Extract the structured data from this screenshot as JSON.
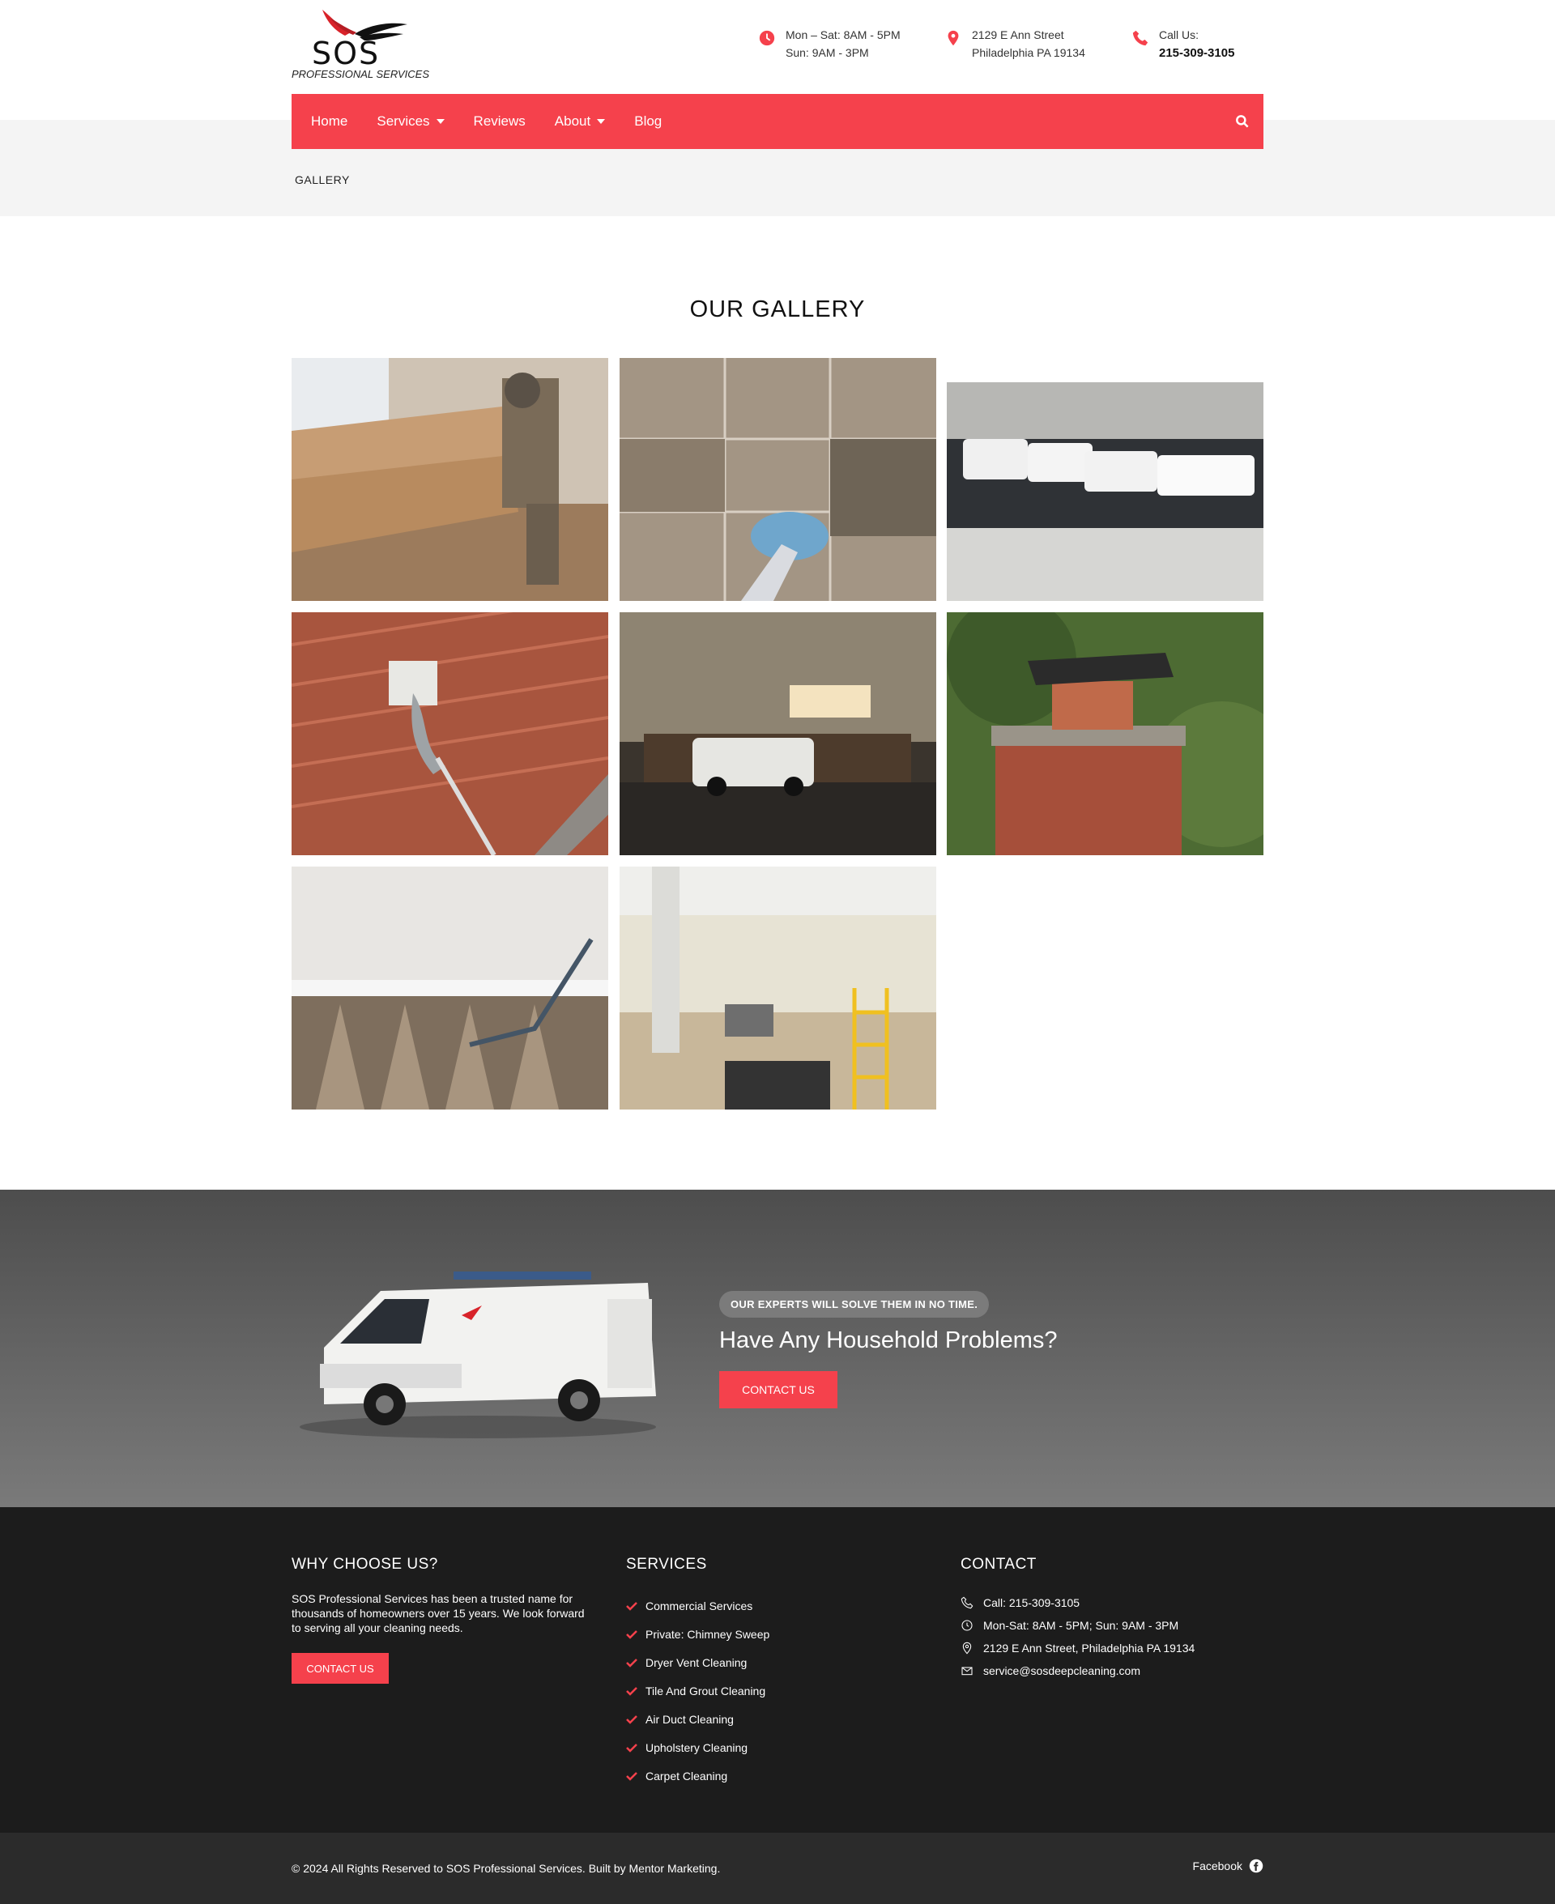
{
  "header": {
    "logo_text": "SOS",
    "logo_subtitle": "PROFESSIONAL SERVICES",
    "hours": [
      "Mon – Sat: 8AM - 5PM",
      "Sun: 9AM - 3PM"
    ],
    "address": [
      "2129 E Ann Street",
      "Philadelphia PA 19134"
    ],
    "call_label": "Call Us:",
    "call_number": "215-309-3105"
  },
  "nav": {
    "items": [
      "Home",
      "Services",
      "Reviews",
      "About",
      "Blog"
    ],
    "accent": "#f5414c"
  },
  "breadcrumb": "GALLERY",
  "gallery": {
    "title": "OUR GALLERY",
    "photos": [
      "sofa-cleaning",
      "tile-cleaning",
      "fleet-vans",
      "dryer-vent",
      "van-at-hotel",
      "chimney-cap",
      "carpet-cleaning",
      "air-duct-office"
    ]
  },
  "cta": {
    "badge": "OUR EXPERTS WILL SOLVE THEM IN NO TIME.",
    "title": "Have Any Household Problems?",
    "button": "CONTACT US"
  },
  "footer": {
    "why": {
      "title": "WHY CHOOSE US?",
      "text": "SOS Professional Services has been a trusted name for thousands of homeowners over 15 years. We look forward to serving all your cleaning needs.",
      "button": "CONTACT US"
    },
    "services": {
      "title": "SERVICES",
      "items": [
        "Commercial Services",
        "Private: Chimney Sweep",
        "Dryer Vent Cleaning",
        "Tile And Grout Cleaning",
        "Air Duct Cleaning",
        "Upholstery Cleaning",
        "Carpet Cleaning"
      ]
    },
    "contact": {
      "title": "CONTACT",
      "phone": "Call: 215-309-3105",
      "hours": "Mon-Sat: 8AM - 5PM; Sun: 9AM - 3PM",
      "address": "2129 E Ann Street, Philadelphia PA 19134",
      "email": "service@sosdeepcleaning.com"
    }
  },
  "bottom": {
    "copyright": "© 2024 All Rights Reserved to SOS Professional Services. Built by Mentor Marketing.",
    "facebook": "Facebook"
  }
}
